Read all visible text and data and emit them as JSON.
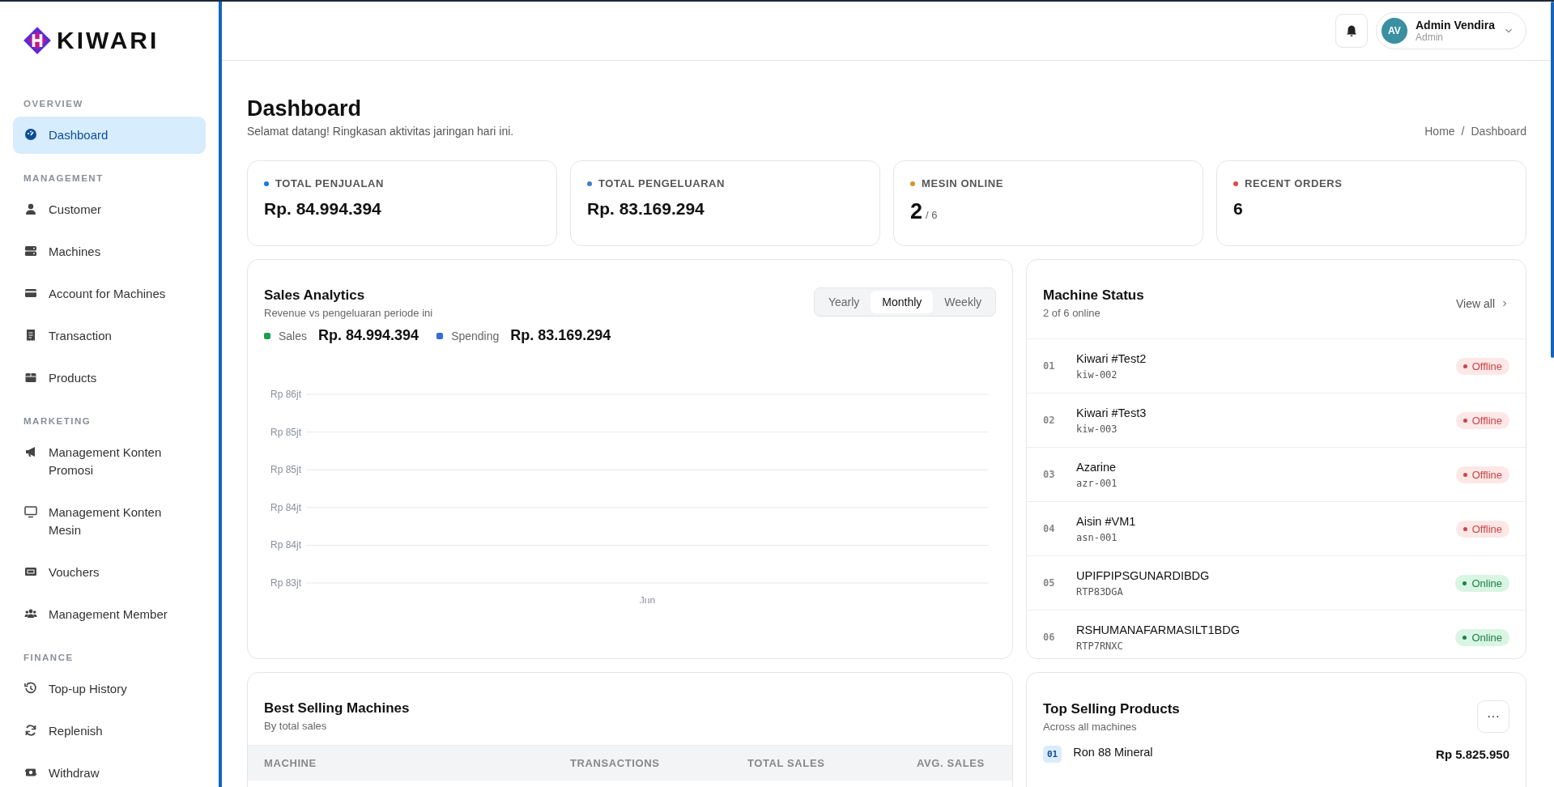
{
  "sidebar": {
    "logo": "KIWARI",
    "sections": [
      {
        "title": "OVERVIEW",
        "items": [
          {
            "label": "Dashboard",
            "selected": true
          }
        ]
      },
      {
        "title": "MANAGEMENT",
        "items": [
          {
            "label": "Customer",
            "selected": false
          },
          {
            "label": "Machines",
            "selected": false
          },
          {
            "label": "Account for Machines",
            "selected": false
          },
          {
            "label": "Transaction",
            "selected": false
          },
          {
            "label": "Products",
            "selected": false
          }
        ]
      },
      {
        "title": "MARKETING",
        "items": [
          {
            "label": "Management Konten Promosi",
            "selected": false
          },
          {
            "label": "Management Konten Mesin",
            "selected": false
          },
          {
            "label": "Vouchers",
            "selected": false
          },
          {
            "label": "Management Member",
            "selected": false
          }
        ]
      },
      {
        "title": "FINANCE",
        "items": [
          {
            "label": "Top-up History",
            "selected": false
          },
          {
            "label": "Replenish",
            "selected": false
          },
          {
            "label": "Withdraw",
            "selected": false
          }
        ]
      }
    ]
  },
  "header": {
    "user": {
      "initials": "AV",
      "name": "Admin Vendira",
      "role": "Admin"
    }
  },
  "page": {
    "title": "Dashboard",
    "subtitle": "Selamat datang! Ringkasan aktivitas jaringan hari ini.",
    "breadcrumb": {
      "items": [
        "Home",
        "Dashboard"
      ],
      "separator": "/"
    }
  },
  "stats": [
    {
      "label": "TOTAL PENJUALAN",
      "value": "Rp. 84.994.394",
      "color": "#1a73e8"
    },
    {
      "label": "TOTAL PENGELUARAN",
      "value": "Rp. 83.169.294",
      "color": "#3b82c4"
    },
    {
      "label": "MESIN ONLINE",
      "value": "2",
      "suffix": "/ 6",
      "color": "#d4962c"
    },
    {
      "label": "RECENT ORDERS",
      "value": "6",
      "color": "#d94a4a"
    }
  ],
  "sales_analytics": {
    "title": "Sales Analytics",
    "subtitle": "Revenue vs pengeluaran periode ini",
    "periods": [
      {
        "label": "Yearly",
        "selected": false
      },
      {
        "label": "Monthly",
        "selected": true
      },
      {
        "label": "Weekly",
        "selected": false
      }
    ],
    "legend": [
      {
        "label": "Sales",
        "value": "Rp. 84.994.394",
        "color": "#1f9d55"
      },
      {
        "label": "Spending",
        "value": "Rp. 83.169.294",
        "color": "#2f6fd6"
      }
    ],
    "y_axis_labels": [
      "Rp 86jt",
      "Rp 85jt",
      "Rp 85jt",
      "Rp 84jt",
      "Rp 84jt",
      "Rp 83jt"
    ],
    "x_axis_labels": [
      "Jun"
    ]
  },
  "machine_status": {
    "title": "Machine Status",
    "subtitle": "2 of 6 online",
    "link": "View all",
    "machines": [
      {
        "number": "01",
        "name": "Kiwari #Test2",
        "code": "kiw-002",
        "status": {
          "kind": "offline",
          "label": "Offline"
        }
      },
      {
        "number": "02",
        "name": "Kiwari #Test3",
        "code": "kiw-003",
        "status": {
          "kind": "offline",
          "label": "Offline"
        }
      },
      {
        "number": "03",
        "name": "Azarine",
        "code": "azr-001",
        "status": {
          "kind": "offline",
          "label": "Offline"
        }
      },
      {
        "number": "04",
        "name": "Aisin #VM1",
        "code": "asn-001",
        "status": {
          "kind": "offline",
          "label": "Offline"
        }
      },
      {
        "number": "05",
        "name": "UPIFPIPSGUNARDIBDG",
        "code": "RTP83DGA",
        "status": {
          "kind": "online",
          "label": "Online"
        }
      },
      {
        "number": "06",
        "name": "RSHUMANAFARMASILT1BDG",
        "code": "RTP7RNXC",
        "status": {
          "kind": "online",
          "label": "Online"
        }
      }
    ]
  },
  "best_selling": {
    "title": "Best Selling Machines",
    "subtitle": "By total sales",
    "columns": [
      "MACHINE",
      "TRANSACTIONS",
      "TOTAL SALES",
      "AVG. SALES"
    ]
  },
  "top_products": {
    "title": "Top Selling Products",
    "subtitle": "Across all machines",
    "more": "···",
    "products": [
      {
        "rank": "01",
        "name": "Ron 88 Mineral",
        "price": "Rp 5.825.950"
      }
    ]
  }
}
